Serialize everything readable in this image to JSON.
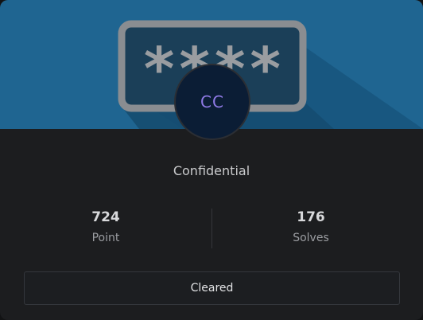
{
  "card": {
    "avatar_text": "CC",
    "banner_glyphs": "****",
    "title": "Confidential",
    "stats": [
      {
        "value": "724",
        "label": "Point"
      },
      {
        "value": "176",
        "label": "Solves"
      }
    ],
    "status_button": "Cleared"
  },
  "colors": {
    "banner_blue": "#1e5f8a",
    "avatar_bg": "#0b1d35",
    "avatar_text": "#8f7ae6",
    "card_bg": "#1c1d1f"
  },
  "icons": {
    "banner": "password-field-icon"
  }
}
